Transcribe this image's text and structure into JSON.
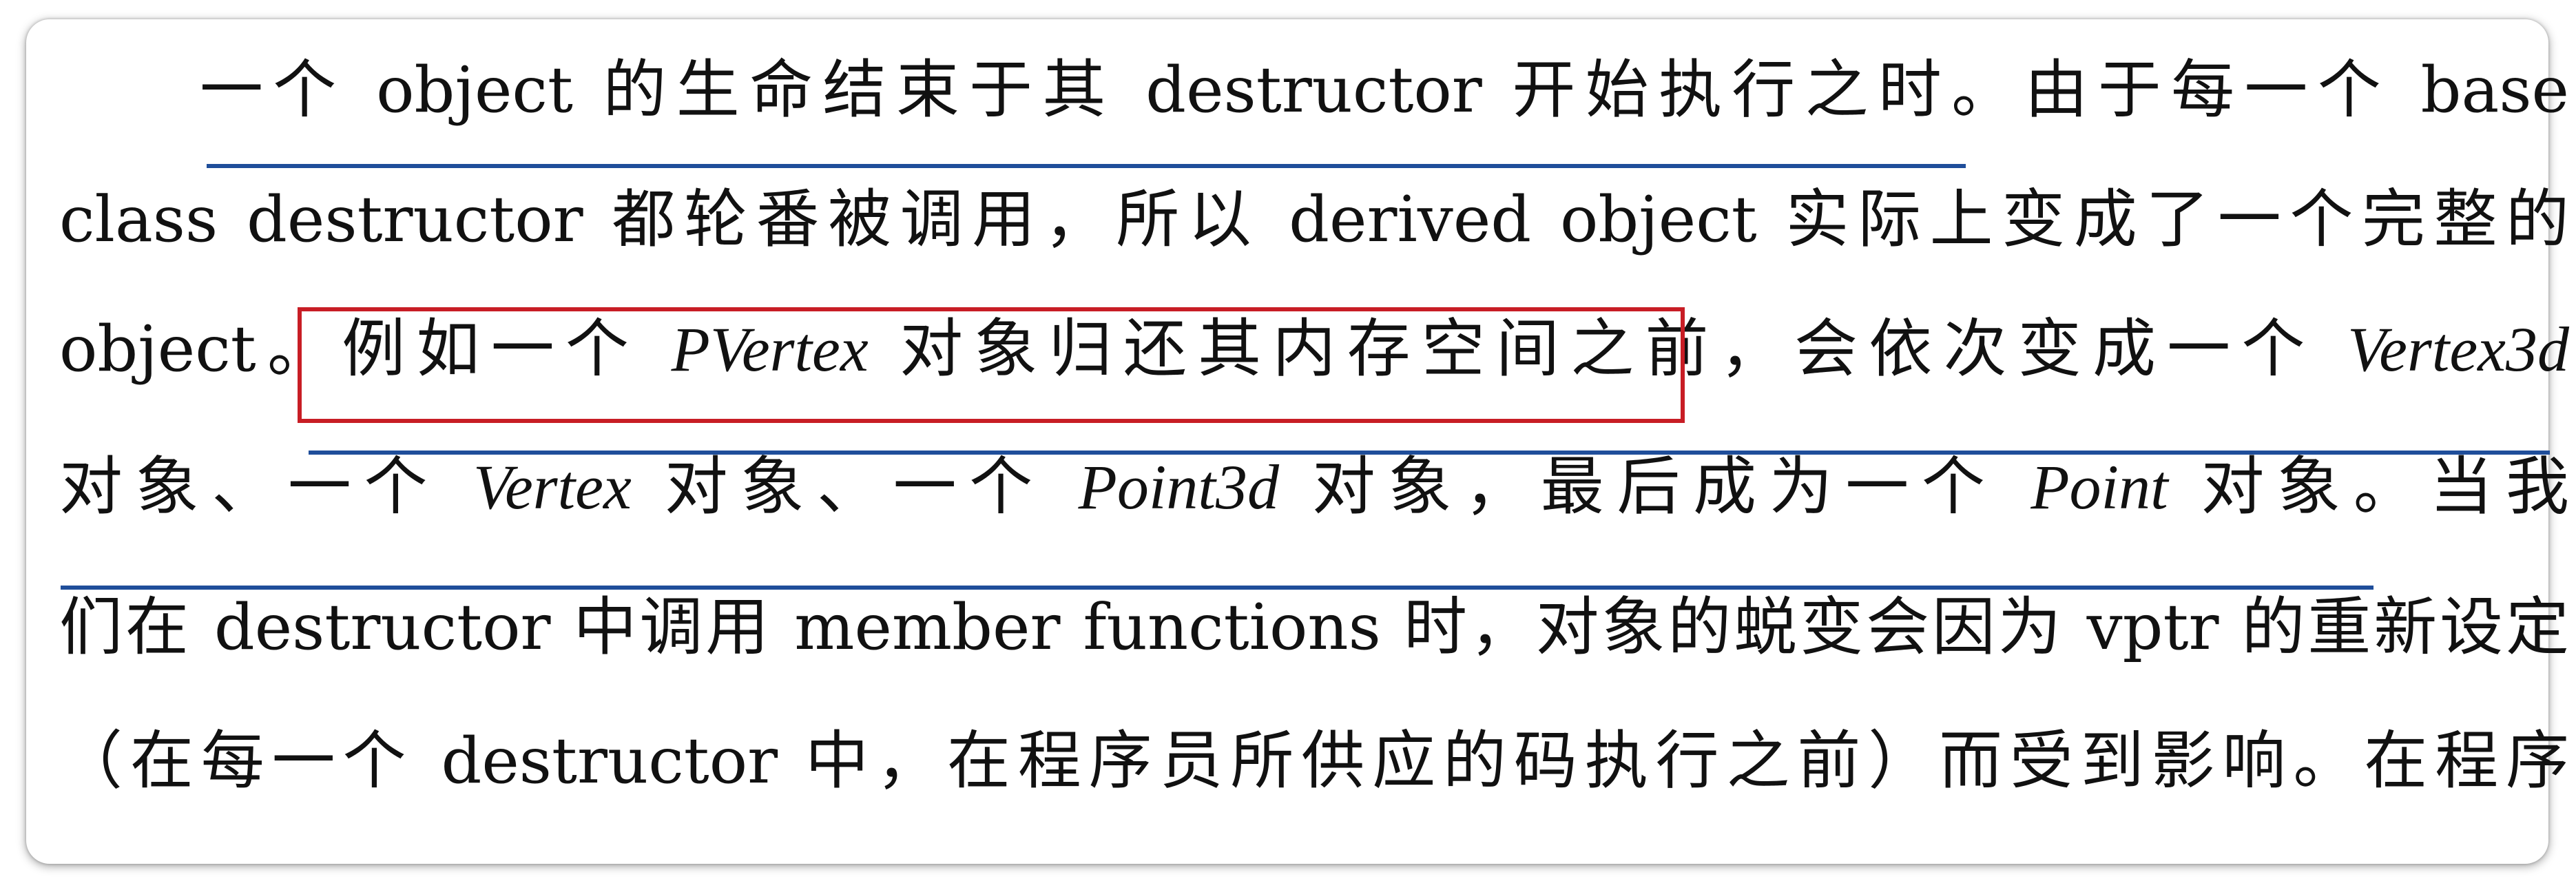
{
  "document": {
    "lines": [
      {
        "segments": [
          {
            "text": "一个 object 的生命结束于其 destructor 开始执行之时。由于每一个 base",
            "style": "normal"
          }
        ]
      },
      {
        "segments": [
          {
            "text": "class destructor 都轮番被调用，所以 derived object 实际上变成了一个完整的",
            "style": "normal"
          }
        ]
      },
      {
        "segments": [
          {
            "text": "object。",
            "style": "normal"
          },
          {
            "text": "例如一个 ",
            "style": "normal"
          },
          {
            "text": "PVertex",
            "style": "italic"
          },
          {
            "text": " 对象归还其内存空间之前",
            "style": "normal"
          },
          {
            "text": "，会依次变成一个 ",
            "style": "normal"
          },
          {
            "text": "Vertex3d",
            "style": "italic"
          }
        ]
      },
      {
        "segments": [
          {
            "text": "对象、一个 ",
            "style": "normal"
          },
          {
            "text": "Vertex",
            "style": "italic"
          },
          {
            "text": " 对象、一个 ",
            "style": "normal"
          },
          {
            "text": "Point3d",
            "style": "italic"
          },
          {
            "text": " 对象，最后成为一个 ",
            "style": "normal"
          },
          {
            "text": "Point",
            "style": "italic"
          },
          {
            "text": " 对象。当我",
            "style": "normal"
          }
        ]
      },
      {
        "segments": [
          {
            "text": "们在 destructor 中调用 member functions 时，对象的蜕变会因为 vptr 的重新设定",
            "style": "normal"
          }
        ]
      },
      {
        "segments": [
          {
            "text": "（在每一个 destructor 中，在程序员所供应的码执行之前）而受到影响。在程序",
            "style": "normal"
          }
        ]
      }
    ],
    "highlight_text": "例如一个 PVertex 对象归还其内存空间之前",
    "colors": {
      "underline": "#1f4e9a",
      "highlight_border": "#c81d25",
      "text": "#111111",
      "background": "#ffffff"
    }
  }
}
